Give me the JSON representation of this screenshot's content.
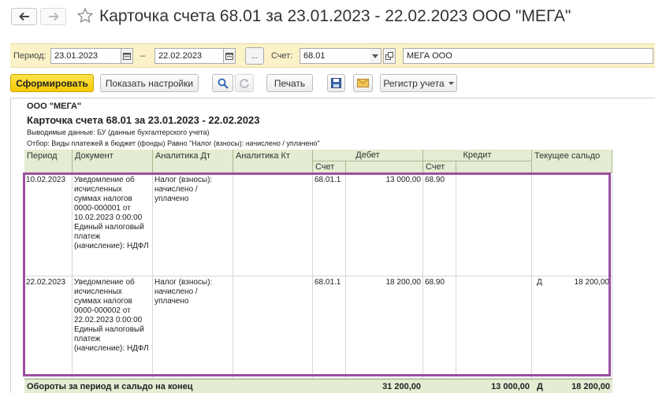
{
  "window": {
    "title": "Карточка счета 68.01 за 23.01.2023 - 22.02.2023 ООО \"МЕГА\"",
    "star_icon": "star-icon"
  },
  "params": {
    "period_label": "Период:",
    "date_from": "23.01.2023",
    "dash": "–",
    "date_to": "22.02.2023",
    "ellipsis": "...",
    "account_label": "Счет:",
    "account_value": "68.01",
    "organization": "МЕГА ООО"
  },
  "toolbar": {
    "generate": "Сформировать",
    "show_settings": "Показать настройки",
    "print": "Печать",
    "register": "Регистр учета"
  },
  "report": {
    "org": "ООО \"МЕГА\"",
    "title": "Карточка счета 68.01 за 23.01.2023 - 22.02.2023",
    "output_data": "Выводимые данные: БУ (данные бухгалтерского учета)",
    "filter": "Отбор: Виды платежей в бюджет (фонды) Равно \"Налог (взносы): начислено / уплачено\"",
    "columns": {
      "period": "Период",
      "document": "Документ",
      "analytics_dt": "Аналитика Дт",
      "analytics_kt": "Аналитика Кт",
      "debit": "Дебет",
      "credit": "Кредит",
      "balance": "Текущее сальдо",
      "account_sub": "Счет"
    },
    "rows": [
      {
        "period": "10.02.2023",
        "document": "Уведомление об исчисленных суммах налогов 0000-000001 от 10.02.2023 0:00:00 Единый налоговый платеж (начисление): НДФЛ",
        "analytics_dt": "Налог (взносы): начислено / уплачено",
        "analytics_kt": "",
        "debit_account": "68.01.1",
        "debit_amount": "13 000,00",
        "credit_account": "68.90",
        "credit_amount": "",
        "balance_side": "",
        "balance_amount": ""
      },
      {
        "period": "22.02.2023",
        "document": "Уведомление об исчисленных суммах налогов 0000-000002 от 22.02.2023 0:00:00 Единый налоговый платеж (начисление): НДФЛ",
        "analytics_dt": "Налог (взносы): начислено / уплачено",
        "analytics_kt": "",
        "debit_account": "68.01.1",
        "debit_amount": "18 200,00",
        "credit_account": "68.90",
        "credit_amount": "",
        "balance_side": "Д",
        "balance_amount": "18 200,00"
      }
    ],
    "totals": {
      "label": "Обороты за период и сальдо на конец",
      "debit": "31 200,00",
      "credit": "13 000,00",
      "balance_side": "Д",
      "balance": "18 200,00"
    }
  },
  "colors": {
    "panel_bg": "#fbf2c8",
    "header_bg": "#e4ecd3",
    "primary_button": "#f5c900",
    "highlight_frame": "#9b4fa0"
  }
}
